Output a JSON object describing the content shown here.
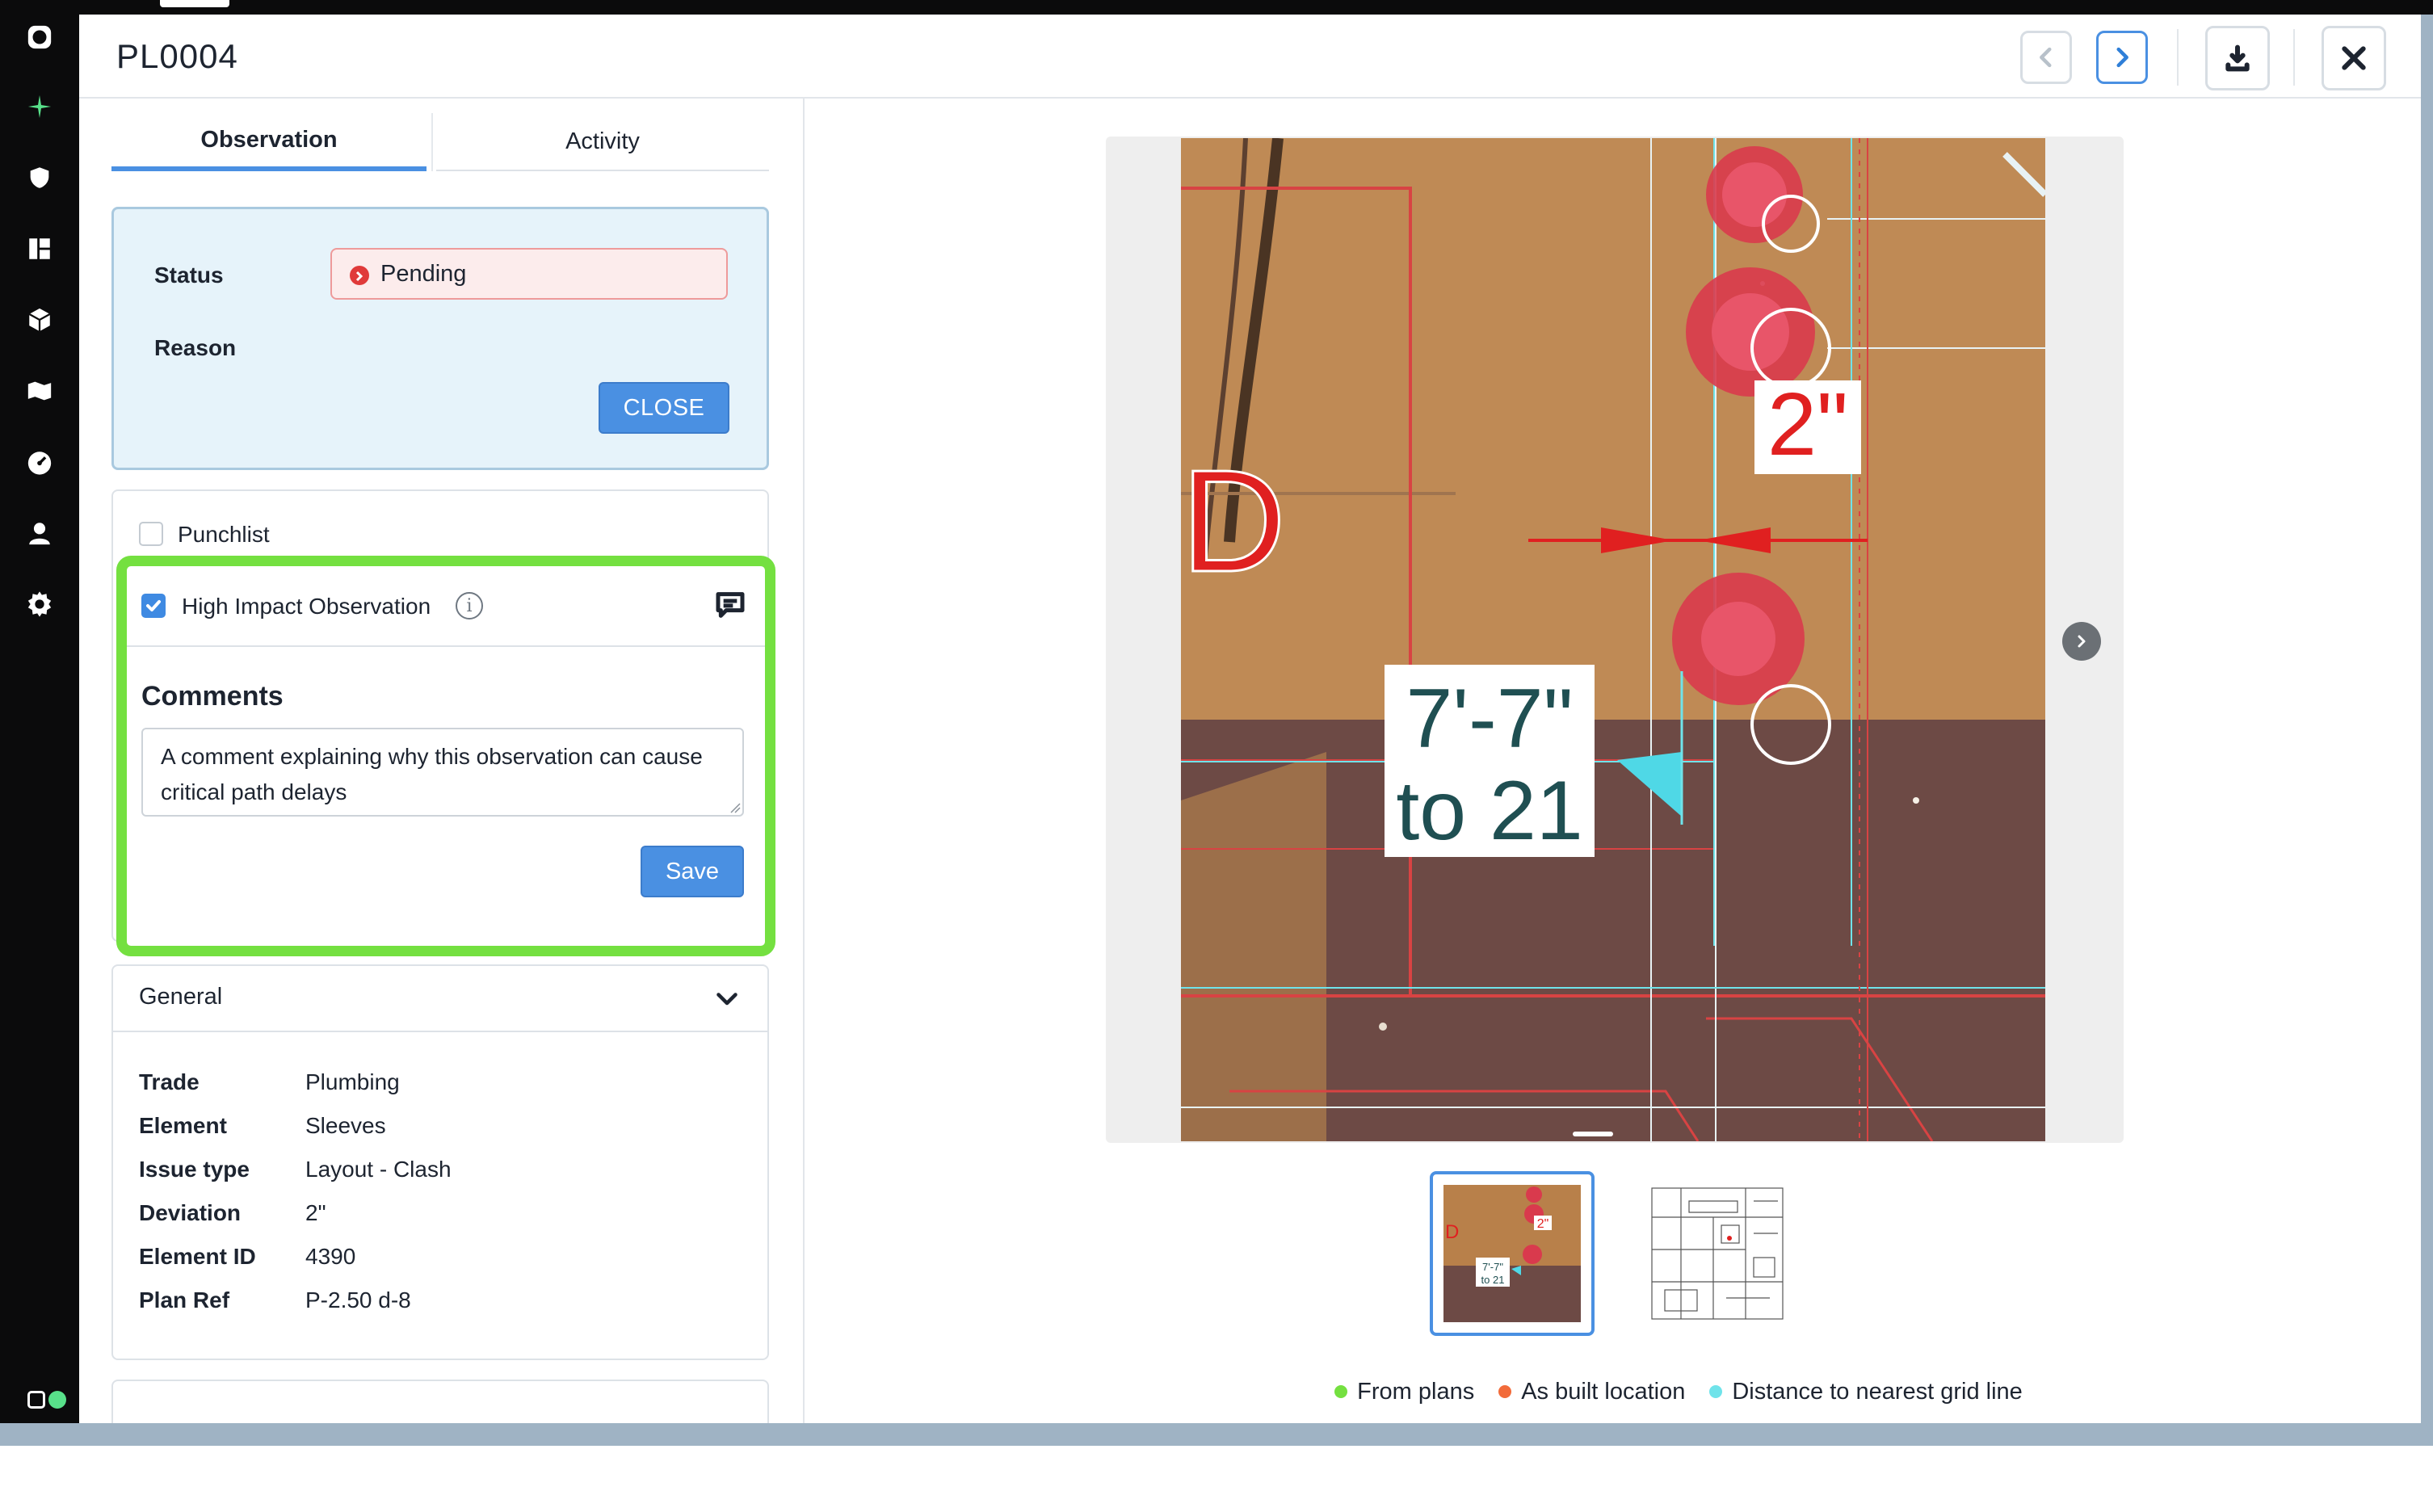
{
  "rail": {
    "icons": [
      "logo-icon",
      "sparkle-icon",
      "shield-icon",
      "layout-icon",
      "cube-icon",
      "map-icon",
      "dashboard-icon",
      "user-icon",
      "settings-icon"
    ]
  },
  "header": {
    "title": "PL0004",
    "buttons": [
      "previous-button",
      "next-button",
      "download-button",
      "close-modal-button"
    ]
  },
  "tabs": {
    "observation": "Observation",
    "activity": "Activity"
  },
  "status_card": {
    "status_label": "Status",
    "status_value": "Pending",
    "status_color": "#e03a3a",
    "reason_label": "Reason",
    "close_label": "CLOSE"
  },
  "observation": {
    "punchlist_label": "Punchlist",
    "punchlist_checked": false,
    "high_impact_label": "High Impact Observation",
    "high_impact_checked": true,
    "info_glyph": "i",
    "comments_title": "Comments",
    "comment_text": "A comment explaining why this observation can cause critical path delays",
    "save_label": "Save"
  },
  "general": {
    "title": "General",
    "fields": [
      {
        "key": "Trade",
        "value": "Plumbing"
      },
      {
        "key": "Element",
        "value": "Sleeves"
      },
      {
        "key": "Issue type",
        "value": "Layout - Clash"
      },
      {
        "key": "Deviation",
        "value": "2\""
      },
      {
        "key": "Element ID",
        "value": "4390"
      },
      {
        "key": "Plan Ref",
        "value": "P-2.50 d-8"
      }
    ]
  },
  "viewer": {
    "annotation_deviation": "2\"",
    "annotation_distance_line1": "7'-7\"",
    "annotation_distance_line2": "to 21",
    "grid_letter": "D",
    "thumb_label_line1": "7'-7\"",
    "thumb_label_line2": "to 21",
    "thumb_deviation": "2\"",
    "thumb_letter": "D"
  },
  "legend": [
    {
      "label": "From plans",
      "color": "#74e040"
    },
    {
      "label": "As built location",
      "color": "#f26b3a"
    },
    {
      "label": "Distance to nearest grid line",
      "color": "#6fe3ea"
    }
  ],
  "colors": {
    "accent": "#4a90e2",
    "highlight": "#74e040",
    "status_bg": "#e6f3fa"
  }
}
